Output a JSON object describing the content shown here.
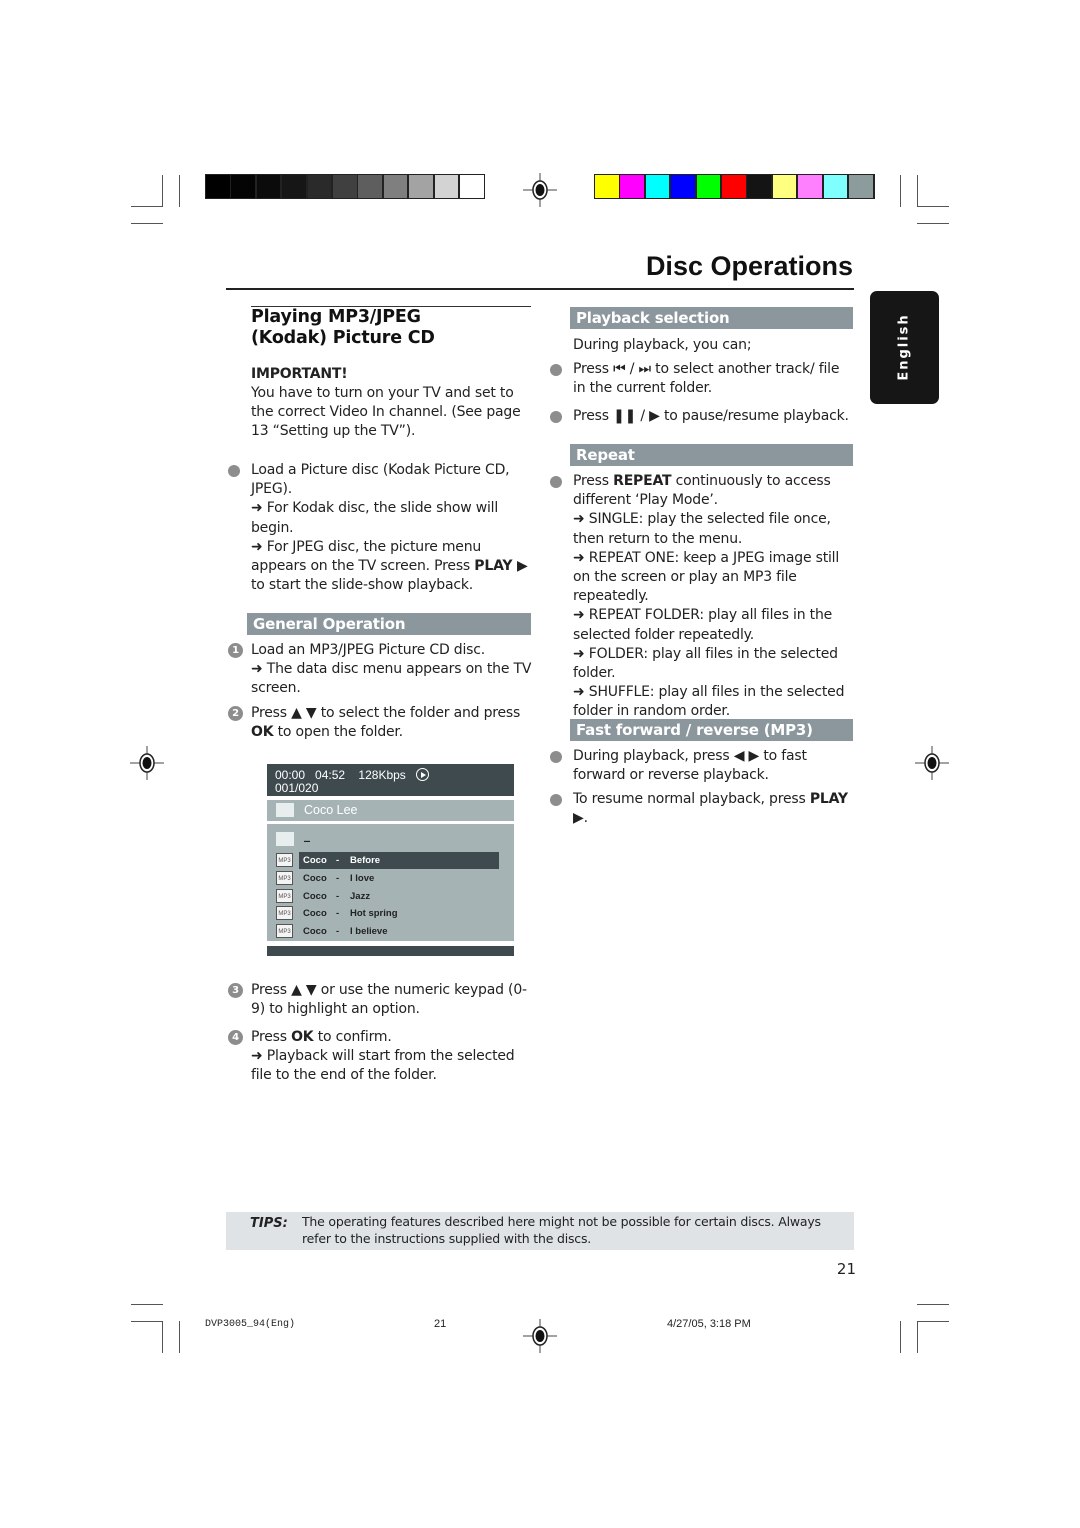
{
  "page_title": "Disc Operations",
  "side_tab": "English",
  "colors": {
    "grayscale": [
      "#000000",
      "#040404",
      "#0b0b0b",
      "#161616",
      "#2a2a2a",
      "#404040",
      "#5e5e5e",
      "#7f7f7f",
      "#a3a3a3",
      "#d3d3d3",
      "#ffffff"
    ],
    "color_bar": [
      "#ffff00",
      "#ff00ff",
      "#00ffff",
      "#0000ff",
      "#00ff00",
      "#ff0000",
      "#141414",
      "#ffff80",
      "#ff80ff",
      "#80ffff",
      "#8c9c9c"
    ],
    "section_bar": "#8b979c",
    "tips_bg": "#dfe3e5"
  },
  "left": {
    "heading": "Playing MP3/JPEG (Kodak) Picture CD",
    "important_label": "IMPORTANT!",
    "important_text": "You have to turn on your TV and set to the correct Video In channel.  (See page 13 “Setting up the TV”).",
    "load_bullet": {
      "text": "Load a Picture disc (Kodak Picture CD, JPEG).",
      "note1": "➜ For Kodak disc, the slide show will begin.",
      "note2_a": "➜ For JPEG disc, the picture menu appears on the TV screen. Press ",
      "note2_b": "PLAY ▶",
      "note2_c": " to start the slide-show playback."
    },
    "general_operation": "General Operation",
    "steps": [
      {
        "num": "1",
        "text": "Load an MP3/JPEG Picture CD disc.",
        "note": "➜ The data disc menu appears on the TV screen."
      },
      {
        "num": "2",
        "text_a": "Press ▲ ▼  to select the folder and press ",
        "bold": "OK",
        "text_b": " to open the folder."
      },
      {
        "num": "3",
        "text": "Press ▲ ▼ or use the numeric keypad (0-9) to highlight an option."
      },
      {
        "num": "4",
        "text_a": "Press ",
        "bold": "OK",
        "text_b": " to confirm.",
        "note": "➜ Playback will start from the selected file to the end of the folder."
      }
    ],
    "screen": {
      "elapsed": "00:00",
      "total": "04:52",
      "bitrate": "128Kbps",
      "track": "001/020",
      "folder": "Coco Lee",
      "parent": "_",
      "file_badge": "MP3",
      "files": [
        {
          "artist": "Coco",
          "sep": "-",
          "title": "Before",
          "selected": true
        },
        {
          "artist": "Coco",
          "sep": "-",
          "title": "I love"
        },
        {
          "artist": "Coco",
          "sep": "-",
          "title": "Jazz"
        },
        {
          "artist": "Coco",
          "sep": "-",
          "title": "Hot spring"
        },
        {
          "artist": "Coco",
          "sep": "-",
          "title": "I believe"
        }
      ]
    }
  },
  "right": {
    "playback_selection": "Playback selection",
    "during": "During playback, you can;",
    "ps_bullets": [
      "Press ⏮ / ⏭ to select another track/ file in the current folder.",
      "Press ❚❚ / ▶ to pause/resume playback."
    ],
    "repeat": "Repeat",
    "repeat_bullet": {
      "a": "Press ",
      "bold": "REPEAT",
      "b": " continuously to access different ‘Play Mode’.",
      "notes": [
        "➜ SINGLE: play the selected file once, then return to the menu.",
        "➜ REPEAT ONE: keep a JPEG image still on the screen or play an MP3 file repeatedly.",
        "➜ REPEAT FOLDER: play all files in the selected folder repeatedly.",
        "➜ FOLDER: play all files in the selected folder.",
        "➜ SHUFFLE: play all files in the selected folder in random order."
      ]
    },
    "fast_forward": "Fast forward / reverse (MP3)",
    "ff_bullets": [
      {
        "text": "During playback, press ◀ ▶ to fast forward or reverse playback."
      },
      {
        "a": "To resume normal playback, press ",
        "bold": "PLAY",
        "b": " ▶."
      }
    ]
  },
  "tips": {
    "label": "TIPS:",
    "text": "The operating features described here might not be possible for certain discs.  Always refer to the instructions supplied with the discs."
  },
  "page_number": "21",
  "footer": {
    "file": "DVP3005_94(Eng)",
    "page": "21",
    "date": "4/27/05, 3:18 PM"
  }
}
